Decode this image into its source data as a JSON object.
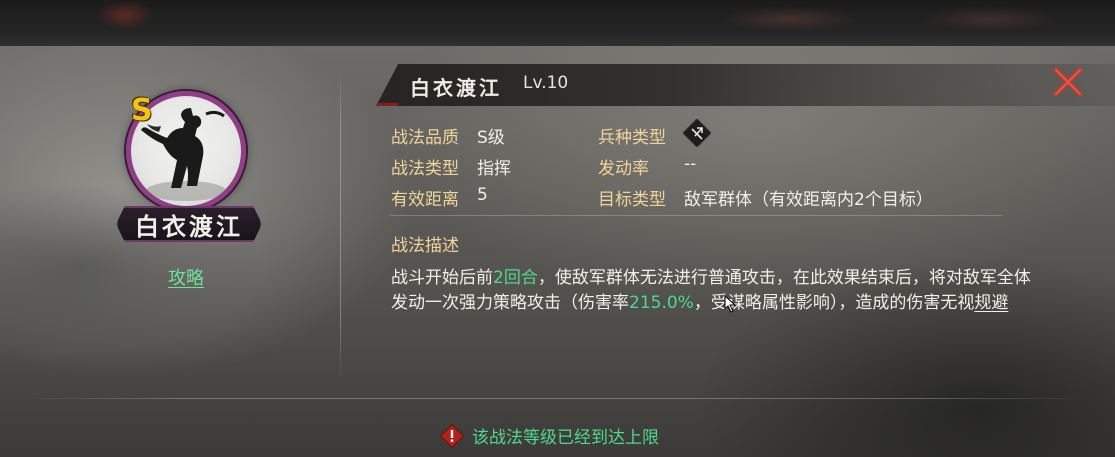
{
  "skill": {
    "portrait_name": "白衣渡江",
    "grade_badge": "S",
    "guide_link": "攻略",
    "title": "白衣渡江",
    "level": "Lv.10"
  },
  "attributes": {
    "quality_label": "战法品质",
    "quality_value": "S级",
    "troop_type_label": "兵种类型",
    "troop_type_icon": "bow-cavalry-icon",
    "skill_type_label": "战法类型",
    "skill_type_value": "指挥",
    "trigger_rate_label": "发动率",
    "trigger_rate_value": "--",
    "range_label": "有效距离",
    "range_value": "5",
    "target_label": "目标类型",
    "target_value": "敌军群体（有效距离内2个目标）"
  },
  "description": {
    "title": "战法描述",
    "part1": "战斗开始后前",
    "highlight1": "2回合",
    "part2": "，使敌军群体无法进行普通攻击，在此效果结束后，将对敌军全体发动一次强力策略攻击（伤害率",
    "highlight2": "215.0%",
    "part3": "，受谋略属性影响），造成的伤害无视",
    "link": "规避"
  },
  "notice": {
    "text": "该战法等级已经到达上限"
  },
  "colors": {
    "label": "#f1d49a",
    "highlight": "#4fd98a",
    "ring": "#8e3f86",
    "close": "#c0392b"
  }
}
